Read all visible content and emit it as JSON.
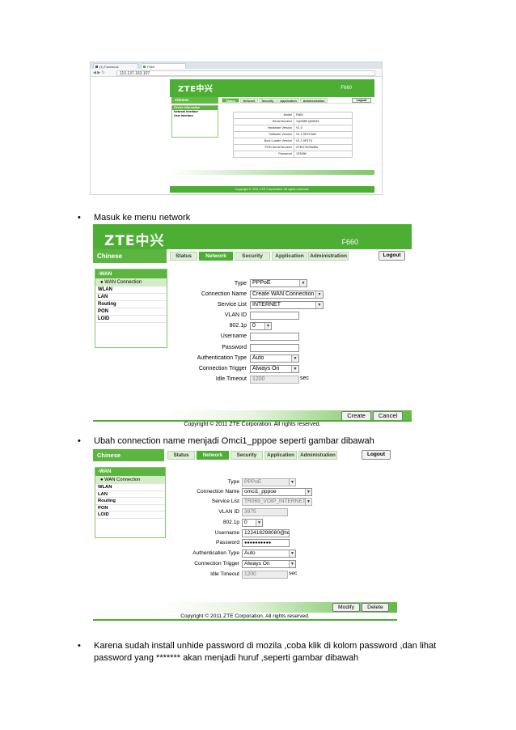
{
  "doc": {
    "bullet_char": "•",
    "items": [
      "Masuk ke menu network",
      "Ubah connection name menjadi Omci1_pppoe seperti gambar dibawah",
      "Karena sudah install unhide password di mozila ,coba klik di kolom password ,dan lihat",
      "password yang ******* akan menjadi huruf ,seperti gambar dibawah"
    ]
  },
  "shot1": {
    "tabs": [
      "(1) Facebook",
      "F660"
    ],
    "url": "110.137.163.107",
    "logo": "ZTE中兴",
    "model": "F660",
    "lang": "Chinese",
    "tabs_nav": [
      "Status",
      "Network",
      "Security",
      "Application",
      "Administration"
    ],
    "logout": "Logout",
    "side_header": "Device Information",
    "side_items": [
      "Network Interface",
      "User Interface"
    ],
    "info": [
      {
        "k": "Model",
        "v": "F660"
      },
      {
        "k": "Serial Number",
        "v": "1Q248B Q00634"
      },
      {
        "k": "Hardware Version",
        "v": "V1.0"
      },
      {
        "k": "Software Version",
        "v": "V1.1.0P2T2dH"
      },
      {
        "k": "Boot Loader Version",
        "v": "V1.1.0P1T4"
      },
      {
        "k": "PON Serial Number",
        "v": "ZTEG7203a45a"
      },
      {
        "k": "Password",
        "v": "123456"
      }
    ],
    "footer": "Copyright © 2011 ZTE Corporation. All rights reserved."
  },
  "shot2": {
    "logo": "ZTE中兴",
    "model": "F660",
    "lang": "Chinese",
    "tabs": [
      "Status",
      "Network",
      "Security",
      "Application",
      "Administration"
    ],
    "logout": "Logout",
    "side_header": "-WAN",
    "side_sub": "WAN Connection",
    "side_items": [
      "WLAN",
      "LAN",
      "Routing",
      "PON",
      "LOID"
    ],
    "form": {
      "type_label": "Type",
      "type_value": "PPPoE",
      "conn_label": "Connection Name",
      "conn_value": "Create WAN Connection",
      "service_label": "Service List",
      "service_value": "INTERNET",
      "vlan_label": "VLAN ID",
      "vlan_value": "",
      "p8021_label": "802.1p",
      "p8021_value": "0",
      "user_label": "Username",
      "user_value": "",
      "pass_label": "Password",
      "pass_value": "",
      "auth_label": "Authentication Type",
      "auth_value": "Auto",
      "trigger_label": "Connection Trigger",
      "trigger_value": "Always On",
      "idle_label": "Idle Timeout",
      "idle_value": "1200",
      "idle_unit": "sec"
    },
    "buttons": [
      "Create",
      "Cancel"
    ],
    "footer": "Copyright © 2011 ZTE Corporation. All rights reserved."
  },
  "shot3": {
    "lang": "Chinese",
    "tabs": [
      "Status",
      "Network",
      "Security",
      "Application",
      "Administration"
    ],
    "logout": "Logout",
    "side_header": "-WAN",
    "side_sub": "WAN Connection",
    "side_items": [
      "WLAN",
      "LAN",
      "Routing",
      "PON",
      "LOID"
    ],
    "form": {
      "type_label": "Type",
      "type_value": "PPPoE",
      "conn_label": "Connection Name",
      "conn_value": "omci1_pppoe",
      "service_label": "Service List",
      "service_value": "TR069_VOIP_INTERNET",
      "vlan_label": "VLAN ID",
      "vlan_value": "3975",
      "p8021_label": "802.1p",
      "p8021_value": "0",
      "user_label": "Username",
      "user_value": "122418298080@te",
      "pass_label": "Password",
      "pass_value": "●●●●●●●●●●",
      "auth_label": "Authentication Type",
      "auth_value": "Auto",
      "trigger_label": "Connection Trigger",
      "trigger_value": "Always On",
      "idle_label": "Idle Timeout",
      "idle_value": "1200",
      "idle_unit": "sec"
    },
    "buttons": [
      "Modify",
      "Delete"
    ],
    "footer": "Copyright © 2011 ZTE Corporation. All rights reserved."
  },
  "colors": {
    "zte_green": "#4cae33",
    "light_green": "#e0f0d8"
  }
}
